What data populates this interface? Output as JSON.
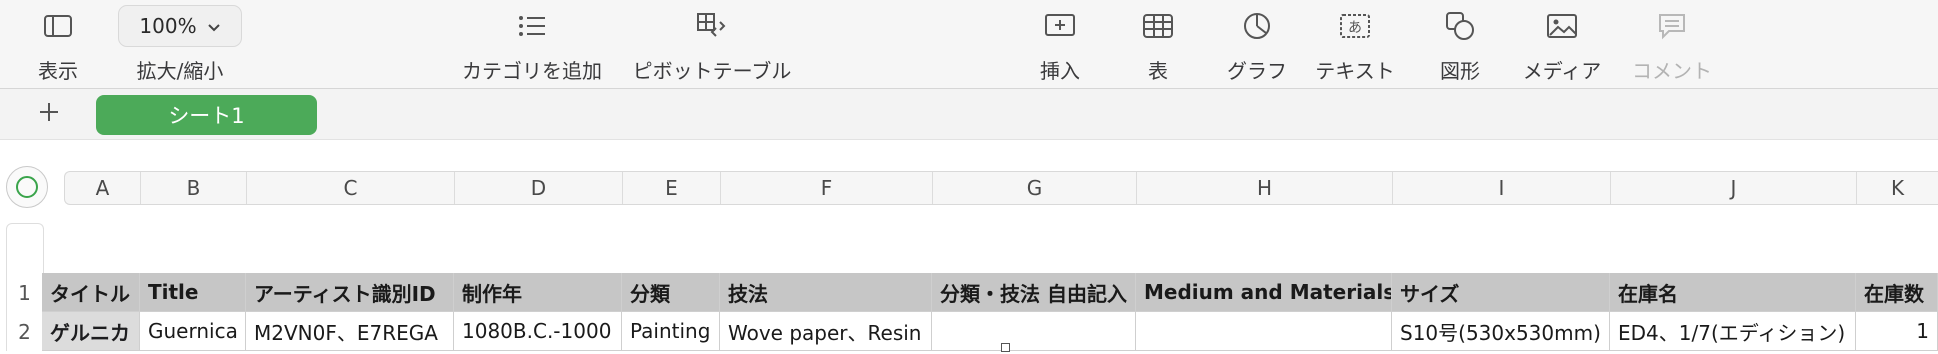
{
  "toolbar": {
    "view_label": "表示",
    "zoom_label": "拡大/縮小",
    "zoom_value": "100%",
    "add_category_label": "カテゴリを追加",
    "pivot_label": "ピボットテーブル",
    "insert_label": "挿入",
    "table_label": "表",
    "chart_label": "グラフ",
    "text_label": "テキスト",
    "shape_label": "図形",
    "media_label": "メディア",
    "comment_label": "コメント"
  },
  "sheets": {
    "active": "シート1"
  },
  "columns": [
    "A",
    "B",
    "C",
    "D",
    "E",
    "F",
    "G",
    "H",
    "I",
    "J",
    "K"
  ],
  "rows": [
    {
      "num": "1",
      "cells": [
        "タイトル",
        "Title",
        "アーティスト識別ID",
        "制作年",
        "分類",
        "技法",
        "分類・技法 自由記入",
        "Medium and Materials",
        "サイズ",
        "在庫名",
        "在庫数"
      ]
    },
    {
      "num": "2",
      "cells": [
        "ゲルニカ",
        "Guernica",
        "M2VN0F、E7REGA",
        "1080B.C.-1000",
        "Painting",
        "Wove paper、Resin",
        "",
        "",
        "S10号(530x530mm)",
        "ED4、1/7(エディション)",
        "1"
      ]
    }
  ],
  "colors": {
    "accent": "#4caa59",
    "header_fill": "#c6c6c6"
  }
}
